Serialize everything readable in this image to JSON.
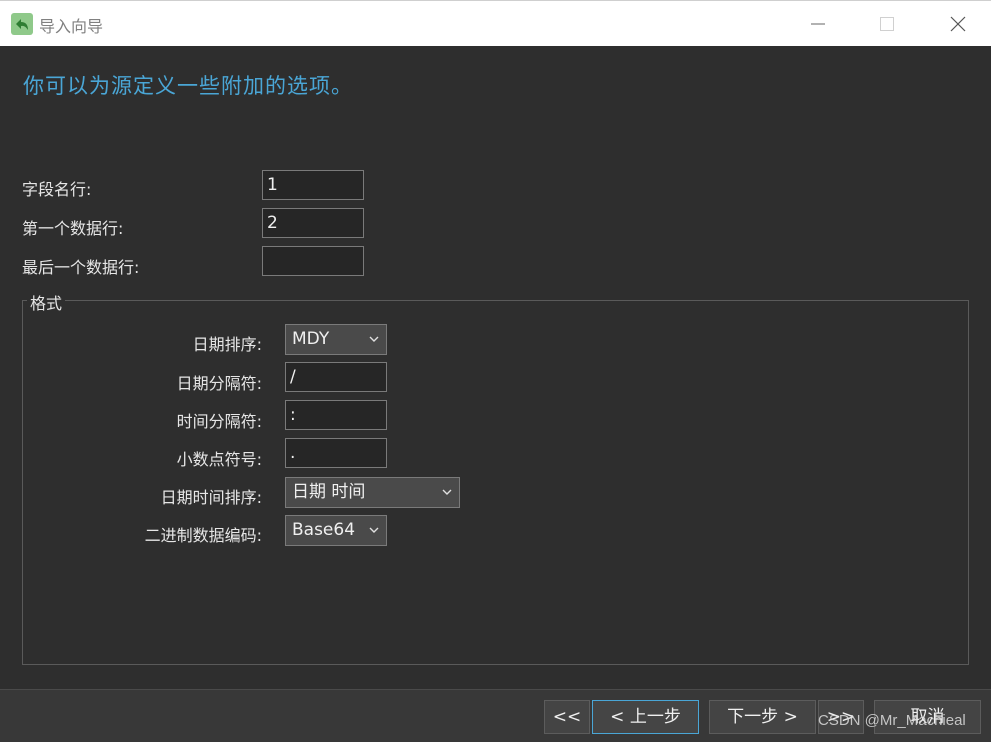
{
  "window": {
    "title": "导入向导"
  },
  "heading": "你可以为源定义一些附加的选项。",
  "fields": {
    "field_name_row_label": "字段名行:",
    "field_name_row_value": "1",
    "first_data_row_label": "第一个数据行:",
    "first_data_row_value": "2",
    "last_data_row_label": "最后一个数据行:",
    "last_data_row_value": ""
  },
  "format": {
    "group_title": "格式",
    "date_order_label": "日期排序:",
    "date_order_value": "MDY",
    "date_sep_label": "日期分隔符:",
    "date_sep_value": "/",
    "time_sep_label": "时间分隔符:",
    "time_sep_value": ":",
    "decimal_label": "小数点符号:",
    "decimal_value": ".",
    "datetime_order_label": "日期时间排序:",
    "datetime_order_value": "日期 时间",
    "binary_encoding_label": "二进制数据编码:",
    "binary_encoding_value": "Base64"
  },
  "buttons": {
    "first": "<<",
    "back": "< 上一步",
    "next": "下一步 >",
    "last": ">>",
    "cancel": "取消"
  },
  "watermark": "CSDN @Mr_Machieal",
  "colors": {
    "accent": "#4aa6d6",
    "background": "#2e2e2e",
    "titlebar": "#ffffff"
  }
}
